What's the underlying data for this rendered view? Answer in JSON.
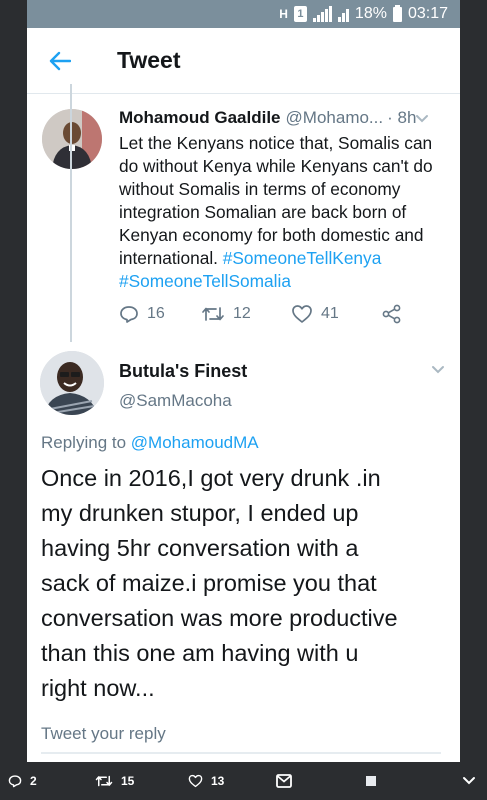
{
  "status_bar": {
    "network_glyph": "H",
    "sim_label": "1",
    "battery_percent": "18%",
    "time": "03:17"
  },
  "app_bar": {
    "title": "Tweet",
    "back_icon": "arrow-left-icon"
  },
  "tweet": {
    "author_name": "Mohamoud Gaaldile",
    "author_handle": "@Mohamo...",
    "time": "· 8h",
    "text_lines": [
      "Let the Kenyans notice that, Somalis can",
      "do without Kenya while Kenyans can't do",
      "without Somalis in terms of economy",
      "integration Somalian are back born of",
      "Kenyan economy for both domestic and",
      "international."
    ],
    "hashtags": [
      "#SomeoneTellKenya",
      "#SomeoneTellSomalia"
    ],
    "replies": "16",
    "retweets": "12",
    "likes": "41"
  },
  "reply": {
    "author_name": "Butula's Finest",
    "author_handle": "@SamMacoha",
    "replying_prefix": "Replying to",
    "replying_to": "@MohamoudMA",
    "text_lines": [
      "Once in 2016,I got very drunk .in",
      "my drunken stupor, I ended up",
      "having 5hr conversation with a",
      "sack of maize.i promise you that",
      "conversation was more productive",
      "than this one am having with u",
      "right now..."
    ]
  },
  "reply_box": {
    "placeholder": "Tweet your reply"
  },
  "bottom_bar": {
    "replies": "2",
    "retweets": "15",
    "likes": "13"
  },
  "colors": {
    "accent": "#1da1f2",
    "text_primary": "#14171a",
    "text_secondary": "#657786",
    "status_bar": "#7b8f9c",
    "frame": "#2b2d30"
  }
}
